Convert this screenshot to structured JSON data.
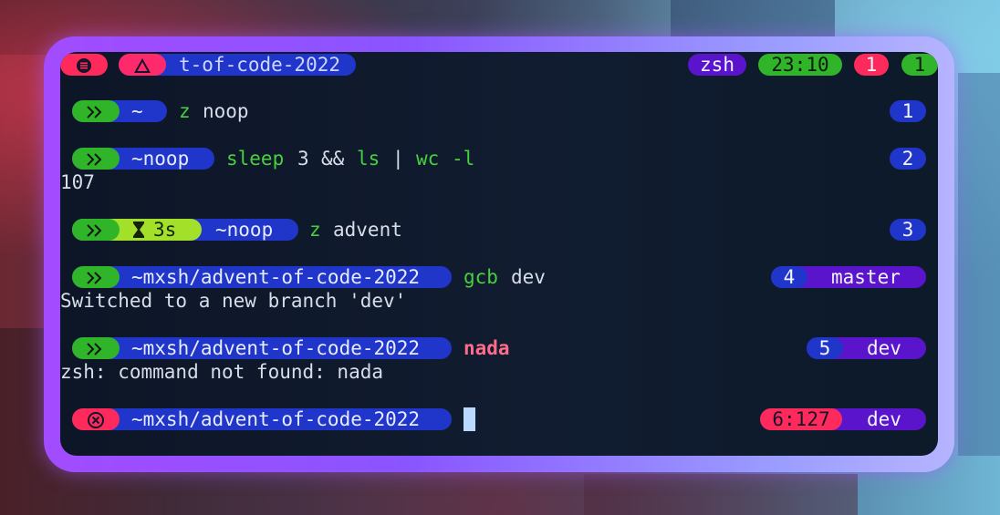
{
  "tabbar": {
    "title": "t-of-code-2022",
    "shell": "zsh",
    "clock": "23:10",
    "errors": "1",
    "jobs": "1"
  },
  "colors": {
    "frame": "#a24bff",
    "terminal_bg": "#0d1627",
    "blue_segment": "#2035c9",
    "green_segment": "#30b42a",
    "error_segment": "#ff2a5c",
    "branch_segment": "#5a14cc",
    "duration_segment": "#a3e02a"
  },
  "icons": {
    "menu": "menu-icon",
    "warning": "warning-icon",
    "success": "chevrons-right-icon",
    "duration": "hourglass-icon",
    "error": "x-circle-icon"
  },
  "lines": [
    {
      "dir": "~",
      "cmd": "z",
      "arg": "noop",
      "num": "1"
    },
    {
      "dir": "~noop",
      "cmd": "sleep",
      "arg": "3",
      "op": "&&",
      "cmd2": "ls",
      "pipe": "|",
      "cmd3": "wc",
      "flag": "-l",
      "num": "2",
      "output": "107"
    },
    {
      "duration": "3s",
      "dir": "~noop",
      "cmd": "z",
      "arg": "advent",
      "num": "3"
    },
    {
      "dir": "~mxsh/advent-of-code-2022",
      "cmd": "gcb",
      "arg": "dev",
      "num": "4",
      "branch": "master",
      "output": "Switched to a new branch 'dev'"
    },
    {
      "dir": "~mxsh/advent-of-code-2022",
      "cmd": "nada",
      "num": "5",
      "branch": "dev",
      "output": "zsh: command not found: nada"
    },
    {
      "dir": "~mxsh/advent-of-code-2022",
      "status": "6:127",
      "branch": "dev"
    }
  ]
}
